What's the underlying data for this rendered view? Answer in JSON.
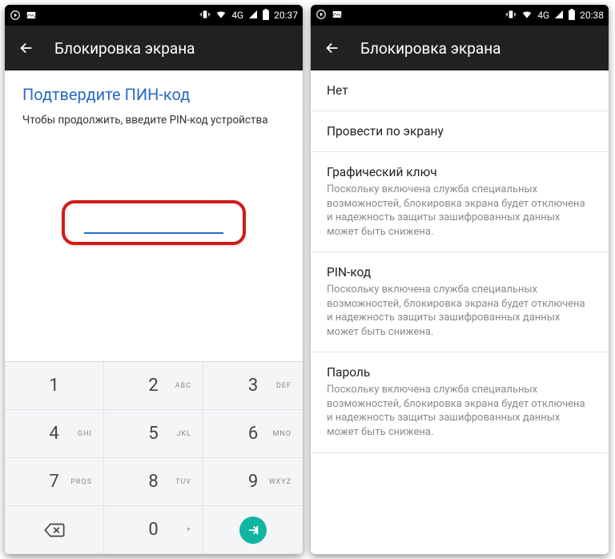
{
  "left": {
    "status": {
      "time": "20:37",
      "network": "4G"
    },
    "appbar": {
      "title": "Блокировка экрана"
    },
    "confirm": {
      "heading": "Подтвердите ПИН-код",
      "subtext": "Чтобы продолжить, введите PIN-код устройства"
    },
    "keypad": {
      "k1": {
        "d": "1",
        "s": ""
      },
      "k2": {
        "d": "2",
        "s": "ABC"
      },
      "k3": {
        "d": "3",
        "s": "DEF"
      },
      "k4": {
        "d": "4",
        "s": "GHI"
      },
      "k5": {
        "d": "5",
        "s": "JKL"
      },
      "k6": {
        "d": "6",
        "s": "MNO"
      },
      "k7": {
        "d": "7",
        "s": "PRQS"
      },
      "k8": {
        "d": "8",
        "s": "TUV"
      },
      "k9": {
        "d": "9",
        "s": "WXYZ"
      },
      "k0": {
        "d": "0",
        "s": "+"
      }
    }
  },
  "right": {
    "status": {
      "time": "20:38",
      "network": "4G"
    },
    "appbar": {
      "title": "Блокировка экрана"
    },
    "options": {
      "none": {
        "title": "Нет"
      },
      "swipe": {
        "title": "Провести по экрану"
      },
      "pattern": {
        "title": "Графический ключ",
        "sub": "Поскольку включена служба специальных возможностей, блокировка экрана будет отключена и надежность защиты зашифрованных данных может быть снижена."
      },
      "pin": {
        "title": "PIN-код",
        "sub": "Поскольку включена служба специальных возможностей, блокировка экрана будет отключена и надежность защиты зашифрованных данных может быть снижена."
      },
      "password": {
        "title": "Пароль",
        "sub": "Поскольку включена служба специальных возможностей, блокировка экрана будет отключена и надежность защиты зашифрованных данных может быть снижена."
      }
    }
  }
}
